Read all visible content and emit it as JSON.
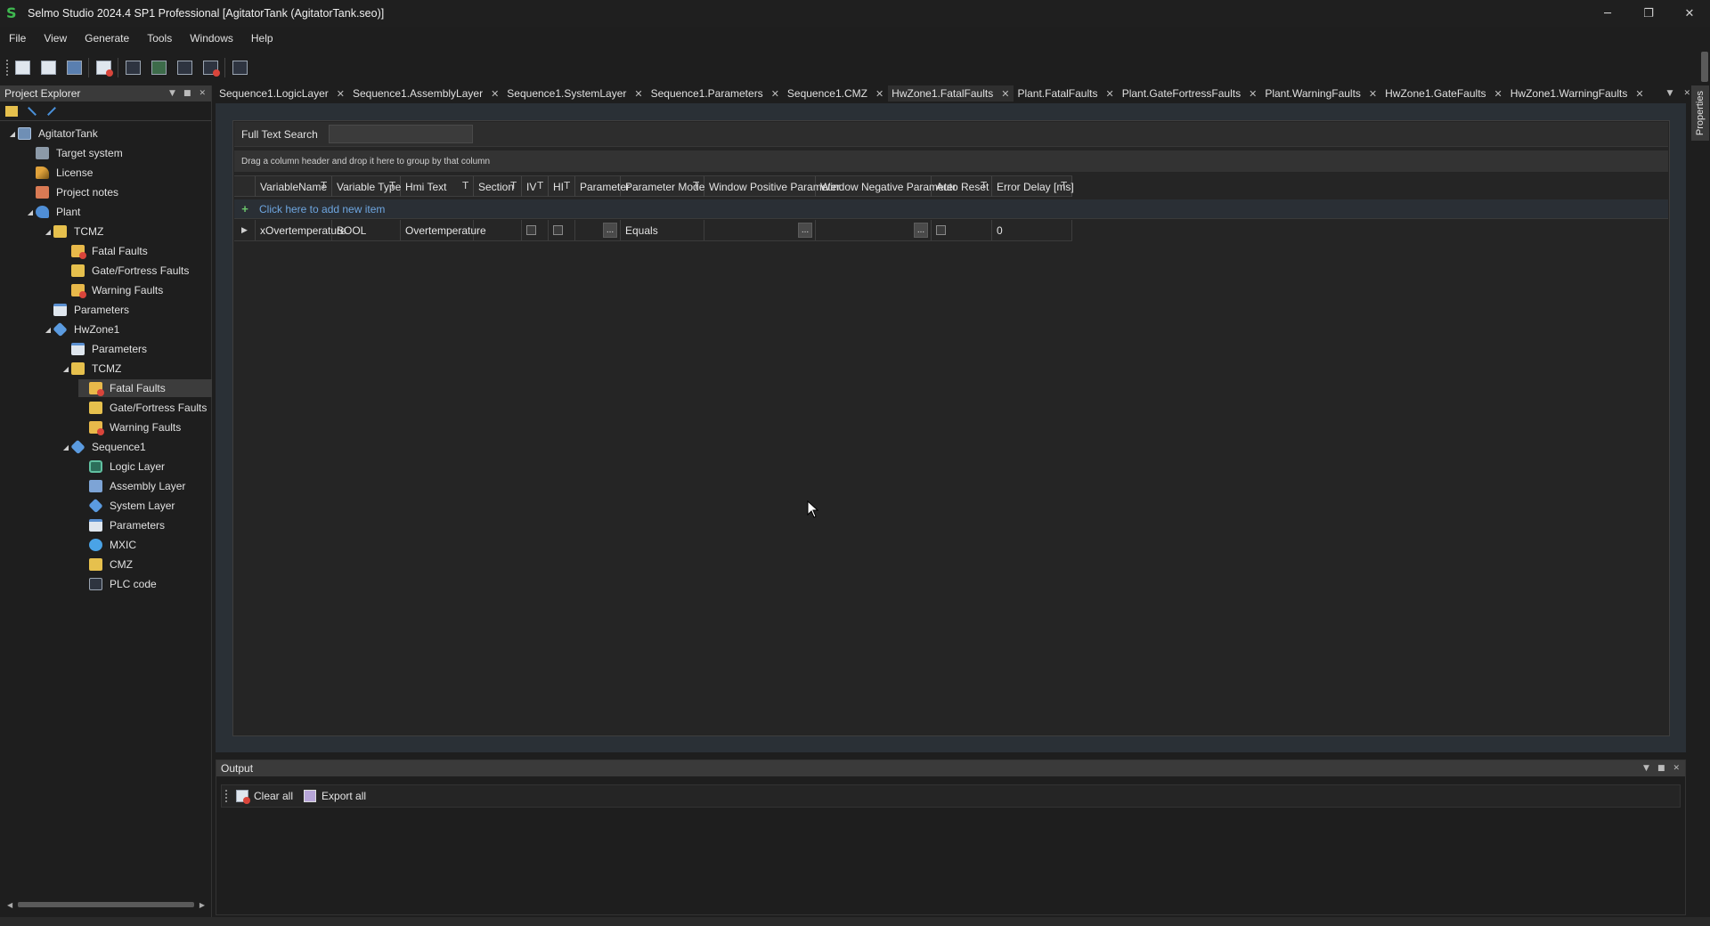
{
  "app": {
    "logo_letter": "S",
    "title": "Selmo Studio 2024.4 SP1 Professional  [AgitatorTank (AgitatorTank.seo)]"
  },
  "window_controls": {
    "minimize": "─",
    "restore": "❐",
    "close": "✕"
  },
  "menu": [
    "File",
    "View",
    "Generate",
    "Tools",
    "Windows",
    "Help"
  ],
  "explorer": {
    "title": "Project Explorer",
    "tree": [
      {
        "label": "AgitatorTank",
        "depth": 0,
        "expander": "◢",
        "icon": "project-icon"
      },
      {
        "label": "Target system",
        "depth": 1,
        "expander": "",
        "icon": "target-system-icon"
      },
      {
        "label": "License",
        "depth": 1,
        "expander": "",
        "icon": "license-key-icon"
      },
      {
        "label": "Project notes",
        "depth": 1,
        "expander": "",
        "icon": "notes-icon"
      },
      {
        "label": "Plant",
        "depth": 1,
        "expander": "◢",
        "icon": "plant-icon"
      },
      {
        "label": "TCMZ",
        "depth": 2,
        "expander": "◢",
        "icon": "folder-icon"
      },
      {
        "label": "Fatal Faults",
        "depth": 3,
        "expander": "",
        "icon": "fatal-faults-icon"
      },
      {
        "label": "Gate/Fortress Faults",
        "depth": 3,
        "expander": "",
        "icon": "gate-faults-icon"
      },
      {
        "label": "Warning Faults",
        "depth": 3,
        "expander": "",
        "icon": "warning-faults-icon"
      },
      {
        "label": "Parameters",
        "depth": 2,
        "expander": "",
        "icon": "parameters-icon"
      },
      {
        "label": "HwZone1",
        "depth": 2,
        "expander": "◢",
        "icon": "hwzone-icon"
      },
      {
        "label": "Parameters",
        "depth": 3,
        "expander": "",
        "icon": "parameters-icon"
      },
      {
        "label": "TCMZ",
        "depth": 3,
        "expander": "◢",
        "icon": "folder-icon"
      },
      {
        "label": "Fatal Faults",
        "depth": 4,
        "expander": "",
        "icon": "fatal-faults-icon",
        "selected": true
      },
      {
        "label": "Gate/Fortress Faults",
        "depth": 4,
        "expander": "",
        "icon": "gate-faults-icon"
      },
      {
        "label": "Warning Faults",
        "depth": 4,
        "expander": "",
        "icon": "warning-faults-icon"
      },
      {
        "label": "Sequence1",
        "depth": 3,
        "expander": "◢",
        "icon": "sequence-icon"
      },
      {
        "label": "Logic Layer",
        "depth": 4,
        "expander": "",
        "icon": "logic-layer-icon"
      },
      {
        "label": "Assembly Layer",
        "depth": 4,
        "expander": "",
        "icon": "assembly-layer-icon"
      },
      {
        "label": "System Layer",
        "depth": 4,
        "expander": "",
        "icon": "system-layer-icon"
      },
      {
        "label": "Parameters",
        "depth": 4,
        "expander": "",
        "icon": "parameters-icon"
      },
      {
        "label": "MXIC",
        "depth": 4,
        "expander": "",
        "icon": "mxic-icon"
      },
      {
        "label": "CMZ",
        "depth": 4,
        "expander": "",
        "icon": "folder-icon"
      },
      {
        "label": "PLC code",
        "depth": 4,
        "expander": "",
        "icon": "plc-code-icon"
      }
    ]
  },
  "tabs": [
    {
      "label": "Sequence1.LogicLayer"
    },
    {
      "label": "Sequence1.AssemblyLayer"
    },
    {
      "label": "Sequence1.SystemLayer"
    },
    {
      "label": "Sequence1.Parameters"
    },
    {
      "label": "Sequence1.CMZ"
    },
    {
      "label": "HwZone1.FatalFaults",
      "active": true
    },
    {
      "label": "Plant.FatalFaults"
    },
    {
      "label": "Plant.GateFortressFaults"
    },
    {
      "label": "Plant.WarningFaults"
    },
    {
      "label": "HwZone1.GateFaults"
    },
    {
      "label": "HwZone1.WarningFaults"
    }
  ],
  "properties_tab": "Properties",
  "grid": {
    "search_label": "Full Text Search",
    "search_value": "",
    "group_hint": "Drag a column header and drop it here to group by that column",
    "columns": [
      {
        "label": "VariableName",
        "filter": true
      },
      {
        "label": "Variable Type",
        "filter": true
      },
      {
        "label": "Hmi Text",
        "filter": true
      },
      {
        "label": "Section",
        "filter": true
      },
      {
        "label": "IV",
        "filter": true
      },
      {
        "label": "HI",
        "filter": true
      },
      {
        "label": "Parameter",
        "filter": false
      },
      {
        "label": "Parameter Mode",
        "filter": true
      },
      {
        "label": "Window Positive Parameter",
        "filter": false
      },
      {
        "label": "Window Negative Parameter",
        "filter": false
      },
      {
        "label": "Auto Reset",
        "filter": true
      },
      {
        "label": "Error Delay [ms]",
        "filter": true
      }
    ],
    "new_row_text": "Click here to add new item",
    "rows": [
      {
        "VariableName": "xOvertemperature",
        "VariableType": "BOOL",
        "HmiText": "Overtemperature",
        "Section": "",
        "IV": false,
        "HI": false,
        "Parameter": "",
        "ParameterMode": "Equals",
        "WindowPositive": "",
        "WindowNegative": "",
        "AutoReset": false,
        "ErrorDelay": "0"
      }
    ],
    "ellipsis_label": "..."
  },
  "output": {
    "title": "Output",
    "clear_all": "Clear all",
    "export_all": "Export all"
  }
}
